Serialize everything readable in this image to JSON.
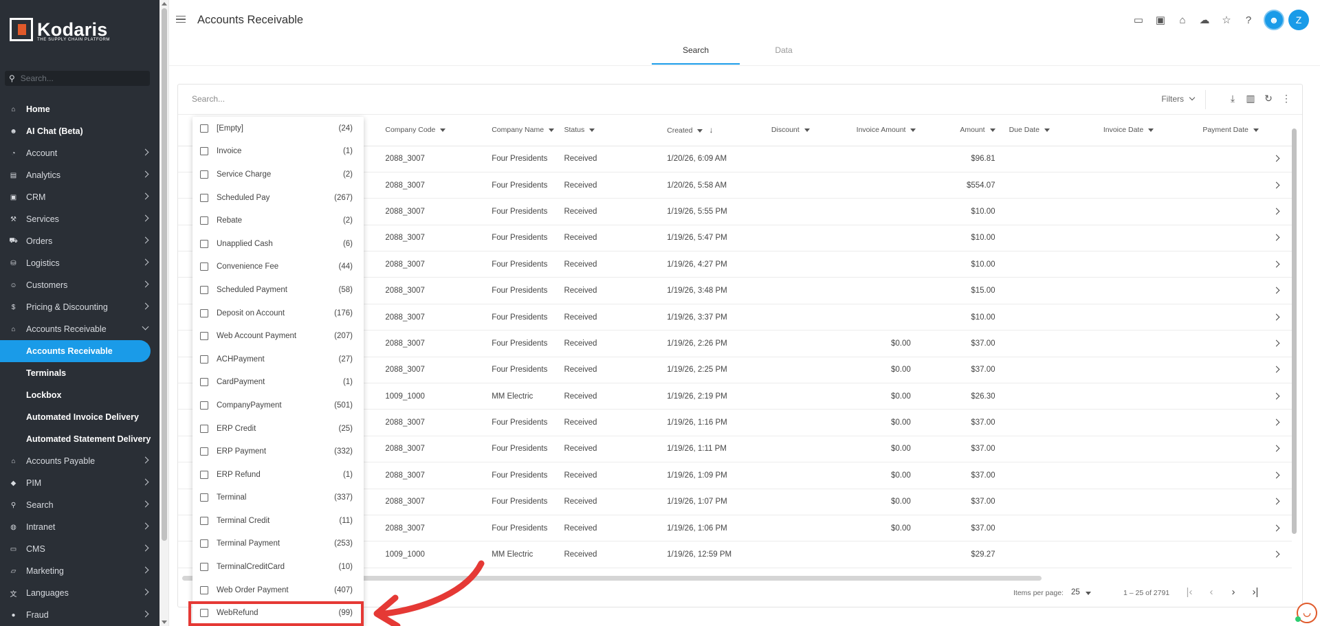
{
  "brand": {
    "name": "Kodaris",
    "tagline": "THE SUPPLY CHAIN PLATFORM"
  },
  "sidebar": {
    "search_placeholder": "Search...",
    "items": [
      {
        "label": "Home",
        "icon": "home-icon",
        "glyph": "⌂",
        "chevron": false
      },
      {
        "label": "AI Chat (Beta)",
        "icon": "robot-icon",
        "glyph": "☻",
        "chevron": false
      },
      {
        "label": "Account",
        "icon": "person-icon",
        "glyph": "◔",
        "chevron": true
      },
      {
        "label": "Analytics",
        "icon": "analytics-icon",
        "glyph": "▤",
        "chevron": true
      },
      {
        "label": "CRM",
        "icon": "crm-icon",
        "glyph": "▣",
        "chevron": true
      },
      {
        "label": "Services",
        "icon": "services-icon",
        "glyph": "⚒",
        "chevron": true
      },
      {
        "label": "Orders",
        "icon": "truck-icon",
        "glyph": "⛟",
        "chevron": true
      },
      {
        "label": "Logistics",
        "icon": "logistics-icon",
        "glyph": "⛁",
        "chevron": true
      },
      {
        "label": "Customers",
        "icon": "customers-icon",
        "glyph": "☺",
        "chevron": true
      },
      {
        "label": "Pricing & Discounting",
        "icon": "dollar-icon",
        "glyph": "$",
        "chevron": true
      },
      {
        "label": "Accounts Receivable",
        "icon": "bank-icon",
        "glyph": "⌂",
        "chevron": "down"
      }
    ],
    "sub_items": [
      "Accounts Receivable",
      "Terminals",
      "Lockbox",
      "Automated Invoice Delivery",
      "Automated Statement Delivery"
    ],
    "items_after": [
      {
        "label": "Accounts Payable",
        "icon": "bank-icon",
        "glyph": "⌂"
      },
      {
        "label": "PIM",
        "icon": "tag-icon",
        "glyph": "◆"
      },
      {
        "label": "Search",
        "icon": "search-icon",
        "glyph": "⚲"
      },
      {
        "label": "Intranet",
        "icon": "globe-icon",
        "glyph": "◍"
      },
      {
        "label": "CMS",
        "icon": "cms-icon",
        "glyph": "▭"
      },
      {
        "label": "Marketing",
        "icon": "marketing-icon",
        "glyph": "▱"
      },
      {
        "label": "Languages",
        "icon": "translate-icon",
        "glyph": "文"
      },
      {
        "label": "Fraud",
        "icon": "fraud-icon",
        "glyph": "●"
      }
    ]
  },
  "header": {
    "title": "Accounts Receivable",
    "avatar": "Z"
  },
  "tabs": [
    "Search",
    "Data"
  ],
  "toolbar": {
    "search_placeholder": "Search...",
    "filters": "Filters"
  },
  "table": {
    "columns": [
      "Company Code",
      "Company Name",
      "Status",
      "Created",
      "Discount",
      "Invoice Amount",
      "Amount",
      "Due Date",
      "Invoice Date",
      "Payment Date"
    ],
    "rows": [
      [
        "2088_3007",
        "Four Presidents",
        "Received",
        "1/20/26, 6:09 AM",
        "",
        "",
        "$96.81"
      ],
      [
        "2088_3007",
        "Four Presidents",
        "Received",
        "1/20/26, 5:58 AM",
        "",
        "",
        "$554.07"
      ],
      [
        "2088_3007",
        "Four Presidents",
        "Received",
        "1/19/26, 5:55 PM",
        "",
        "",
        "$10.00"
      ],
      [
        "2088_3007",
        "Four Presidents",
        "Received",
        "1/19/26, 5:47 PM",
        "",
        "",
        "$10.00"
      ],
      [
        "2088_3007",
        "Four Presidents",
        "Received",
        "1/19/26, 4:27 PM",
        "",
        "",
        "$10.00"
      ],
      [
        "2088_3007",
        "Four Presidents",
        "Received",
        "1/19/26, 3:48 PM",
        "",
        "",
        "$15.00"
      ],
      [
        "2088_3007",
        "Four Presidents",
        "Received",
        "1/19/26, 3:37 PM",
        "",
        "",
        "$10.00"
      ],
      [
        "2088_3007",
        "Four Presidents",
        "Received",
        "1/19/26, 2:26 PM",
        "",
        "$0.00",
        "$37.00"
      ],
      [
        "2088_3007",
        "Four Presidents",
        "Received",
        "1/19/26, 2:25 PM",
        "",
        "$0.00",
        "$37.00"
      ],
      [
        "1009_1000",
        "MM Electric",
        "Received",
        "1/19/26, 2:19 PM",
        "",
        "$0.00",
        "$26.30"
      ],
      [
        "2088_3007",
        "Four Presidents",
        "Received",
        "1/19/26, 1:16 PM",
        "",
        "$0.00",
        "$37.00"
      ],
      [
        "2088_3007",
        "Four Presidents",
        "Received",
        "1/19/26, 1:11 PM",
        "",
        "$0.00",
        "$37.00"
      ],
      [
        "2088_3007",
        "Four Presidents",
        "Received",
        "1/19/26, 1:09 PM",
        "",
        "$0.00",
        "$37.00"
      ],
      [
        "2088_3007",
        "Four Presidents",
        "Received",
        "1/19/26, 1:07 PM",
        "",
        "$0.00",
        "$37.00"
      ],
      [
        "2088_3007",
        "Four Presidents",
        "Received",
        "1/19/26, 1:06 PM",
        "",
        "$0.00",
        "$37.00"
      ],
      [
        "1009_1000",
        "MM Electric",
        "Received",
        "1/19/26, 12:59 PM",
        "",
        "",
        "$29.27"
      ]
    ]
  },
  "filter_options": [
    {
      "label": "[Empty]",
      "count": "(24)"
    },
    {
      "label": "Invoice",
      "count": "(1)"
    },
    {
      "label": "Service Charge",
      "count": "(2)"
    },
    {
      "label": "Scheduled Pay",
      "count": "(267)"
    },
    {
      "label": "Rebate",
      "count": "(2)"
    },
    {
      "label": "Unapplied Cash",
      "count": "(6)"
    },
    {
      "label": "Convenience Fee",
      "count": "(44)"
    },
    {
      "label": "Scheduled Payment",
      "count": "(58)"
    },
    {
      "label": "Deposit on Account",
      "count": "(176)"
    },
    {
      "label": "Web Account Payment",
      "count": "(207)"
    },
    {
      "label": "ACHPayment",
      "count": "(27)"
    },
    {
      "label": "CardPayment",
      "count": "(1)"
    },
    {
      "label": "CompanyPayment",
      "count": "(501)"
    },
    {
      "label": "ERP Credit",
      "count": "(25)"
    },
    {
      "label": "ERP Payment",
      "count": "(332)"
    },
    {
      "label": "ERP Refund",
      "count": "(1)"
    },
    {
      "label": "Terminal",
      "count": "(337)"
    },
    {
      "label": "Terminal Credit",
      "count": "(11)"
    },
    {
      "label": "Terminal Payment",
      "count": "(253)"
    },
    {
      "label": "TerminalCreditCard",
      "count": "(10)"
    },
    {
      "label": "Web Order Payment",
      "count": "(407)"
    },
    {
      "label": "WebRefund",
      "count": "(99)"
    }
  ],
  "pagination": {
    "items_per_page_label": "Items per page:",
    "items_per_page": "25",
    "range": "1 – 25 of 2791"
  },
  "colors": {
    "accent": "#1a9be8",
    "sidebar_bg": "#2a2f36",
    "highlight": "#e53935",
    "brand_orange": "#e0592a"
  }
}
